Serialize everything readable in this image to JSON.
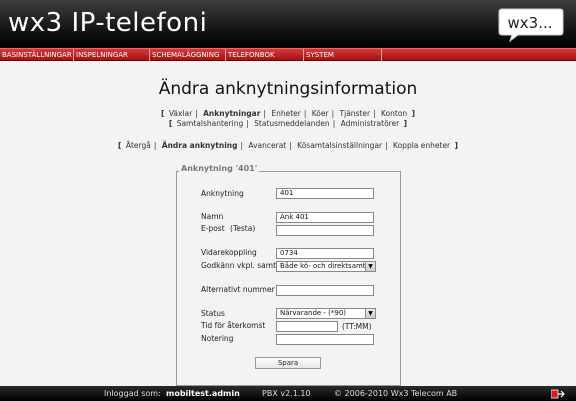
{
  "header": {
    "logo": "wx3 IP-telefoni",
    "badge": "wx3..."
  },
  "menu": [
    "BASINSTÄLLNINGAR",
    "INSPELNINGAR",
    "SCHEMALÄGGNING",
    "TELEFONBOK",
    "SYSTEM"
  ],
  "page_title": "Ändra anknytningsinformation",
  "nav1": {
    "row1": [
      "Växlar",
      "Anknytningar",
      "Enheter",
      "Köer",
      "Tjänster",
      "Konton"
    ],
    "row2": [
      "Samtalshantering",
      "Statusmeddelanden",
      "Administratörer"
    ],
    "active": "Anknytningar"
  },
  "nav2": {
    "items": [
      "Återgå",
      "Ändra anknytning",
      "Avancerat",
      "Kösamtalsinställningar",
      "Koppla enheter"
    ],
    "active": "Ändra anknytning"
  },
  "form": {
    "legend": "Anknytning '401'",
    "anknytning_label": "Anknytning",
    "anknytning_value": "401",
    "namn_label": "Namn",
    "namn_value": "Ank 401",
    "epost_label": "E-post",
    "testa_label": "(Testa)",
    "epost_value": "",
    "vidarekoppling_label": "Vidarekoppling",
    "vidarekoppling_value": "0734",
    "godkann_label": "Godkänn vkpl. samtal",
    "godkann_value": "Både kö- och direktsamtal",
    "alt_label": "Alternativt nummer",
    "alt_value": "",
    "status_label": "Status",
    "status_value": "Närvarande - (*90)",
    "tid_label": "Tid för återkomst",
    "tid_value": "",
    "tid_hint": "(TT:MM)",
    "notering_label": "Notering",
    "notering_value": "",
    "save_label": "Spara"
  },
  "footer": {
    "logged_in_label": "Inloggad som:",
    "user": "mobiltest.admin",
    "version": "PBX v2.1.10",
    "copyright": "© 2006-2010 Wx3 Telecom AB"
  },
  "colors": {
    "menu_red": "#b51a1a",
    "header_black": "#161616"
  }
}
